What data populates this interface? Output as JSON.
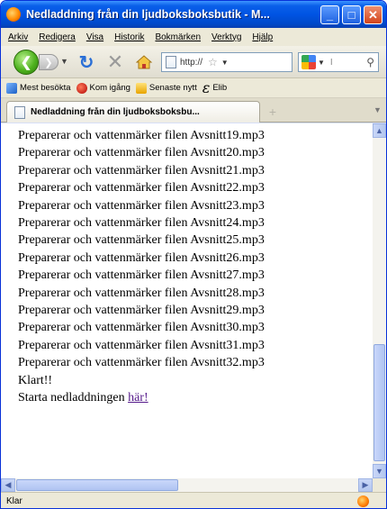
{
  "window": {
    "title": "Nedladdning från din ljudboksboksbutik - M...",
    "buttons": {
      "minimize": "_",
      "maximize": "□",
      "close": "✕"
    }
  },
  "menu": {
    "items": [
      "Arkiv",
      "Redigera",
      "Visa",
      "Historik",
      "Bokmärken",
      "Verktyg",
      "Hjälp"
    ]
  },
  "nav": {
    "url_value": "http://",
    "icons": {
      "back": "back-arrow-icon",
      "forward": "forward-arrow-icon",
      "reload": "reload-icon",
      "stop": "stop-icon",
      "home": "home-icon",
      "star": "bookmark-star-icon",
      "search_engine": "google-icon",
      "search": "search-icon"
    },
    "search_value": "I"
  },
  "bookmarks": {
    "items": [
      "Mest besökta",
      "Kom igång",
      "Senaste nytt",
      "Elib"
    ]
  },
  "tab": {
    "title": "Nedladdning från din ljudboksboksbu...",
    "new_tab_label": "+"
  },
  "content": {
    "lines": [
      "Preparerar och vattenmärker filen Avsnitt19.mp3",
      "Preparerar och vattenmärker filen Avsnitt20.mp3",
      "Preparerar och vattenmärker filen Avsnitt21.mp3",
      "Preparerar och vattenmärker filen Avsnitt22.mp3",
      "Preparerar och vattenmärker filen Avsnitt23.mp3",
      "Preparerar och vattenmärker filen Avsnitt24.mp3",
      "Preparerar och vattenmärker filen Avsnitt25.mp3",
      "Preparerar och vattenmärker filen Avsnitt26.mp3",
      "Preparerar och vattenmärker filen Avsnitt27.mp3",
      "Preparerar och vattenmärker filen Avsnitt28.mp3",
      "Preparerar och vattenmärker filen Avsnitt29.mp3",
      "Preparerar och vattenmärker filen Avsnitt30.mp3",
      "Preparerar och vattenmärker filen Avsnitt31.mp3",
      "Preparerar och vattenmärker filen Avsnitt32.mp3"
    ],
    "done_text": "Klart!!",
    "start_text": "Starta nedladdningen ",
    "start_link": "här!"
  },
  "status": {
    "text": "Klar"
  },
  "colors": {
    "titlebar": "#0054e3",
    "link_visited": "#551a8b",
    "chrome": "#ece9d8"
  }
}
